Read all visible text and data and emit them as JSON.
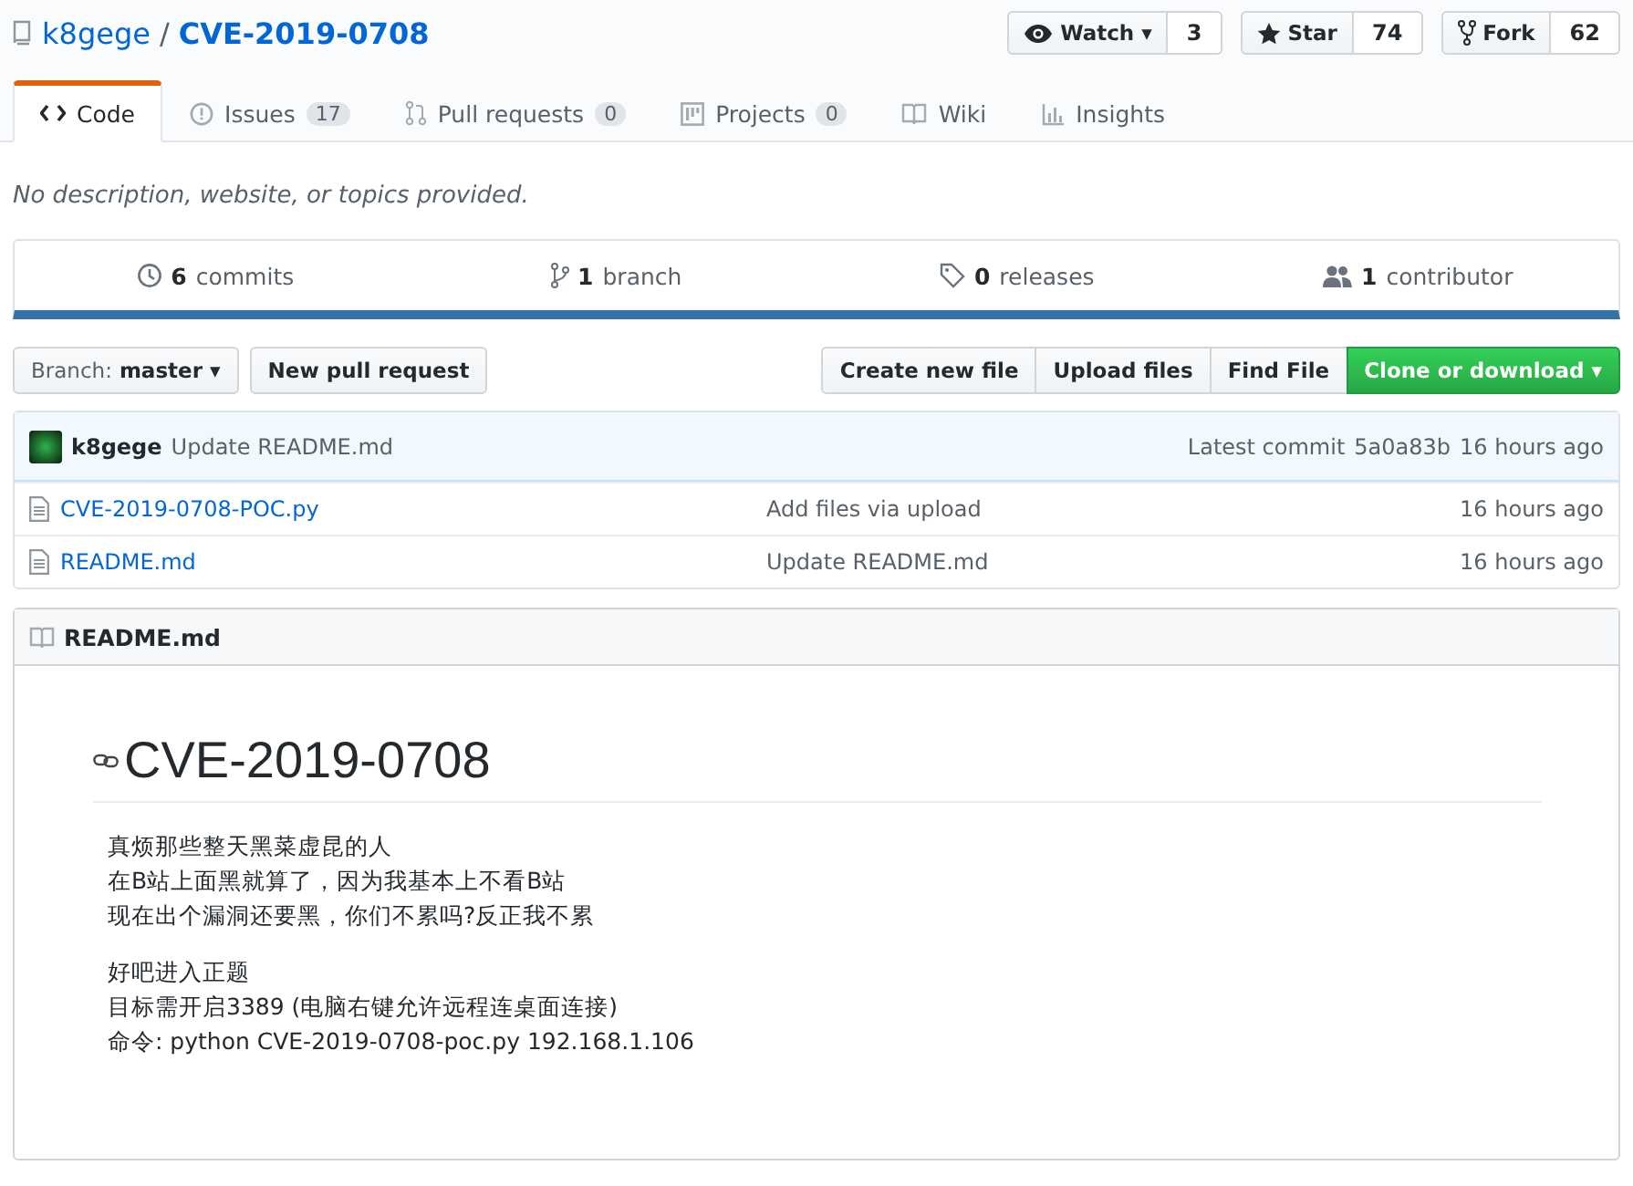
{
  "repo": {
    "owner": "k8gege",
    "separator": "/",
    "name": "CVE-2019-0708"
  },
  "actions": [
    {
      "label": "Watch",
      "caret": "▾",
      "count": "3"
    },
    {
      "label": "Star",
      "count": "74"
    },
    {
      "label": "Fork",
      "count": "62"
    }
  ],
  "tabs": [
    {
      "label": "Code",
      "selected": true
    },
    {
      "label": "Issues",
      "count": "17",
      "selected": false
    },
    {
      "label": "Pull requests",
      "count": "0",
      "selected": false
    },
    {
      "label": "Projects",
      "count": "0",
      "selected": false
    },
    {
      "label": "Wiki",
      "selected": false
    },
    {
      "label": "Insights",
      "selected": false
    }
  ],
  "description": "No description, website, or topics provided.",
  "summary": [
    {
      "count": "6",
      "label": "commits"
    },
    {
      "count": "1",
      "label": "branch"
    },
    {
      "count": "0",
      "label": "releases"
    },
    {
      "count": "1",
      "label": "contributor"
    }
  ],
  "branch": {
    "label": "Branch:",
    "value": "master",
    "caret": "▾"
  },
  "new_pull_request": "New pull request",
  "file_buttons": [
    "Create new file",
    "Upload files",
    "Find File"
  ],
  "clone_button": {
    "label": "Clone or download",
    "caret": "▾"
  },
  "latest_commit": {
    "author": "k8gege",
    "message": "Update README.md",
    "label": "Latest commit",
    "sha": "5a0a83b",
    "time": "16 hours ago"
  },
  "files": [
    {
      "name": "CVE-2019-0708-POC.py",
      "message": "Add files via upload",
      "time": "16 hours ago"
    },
    {
      "name": "README.md",
      "message": "Update README.md",
      "time": "16 hours ago"
    }
  ],
  "readme": {
    "title": "README.md",
    "heading": "CVE-2019-0708",
    "paragraphs": [
      [
        "真烦那些整天黑菜虚昆的人",
        "在B站上面黑就算了，因为我基本上不看B站",
        "现在出个漏洞还要黑，你们不累吗?反正我不累"
      ],
      [
        "好吧进入正题",
        "目标需开启3389 (电脑右键允许远程连桌面连接)",
        "命令: python CVE-2019-0708-poc.py 192.168.1.106"
      ]
    ]
  }
}
